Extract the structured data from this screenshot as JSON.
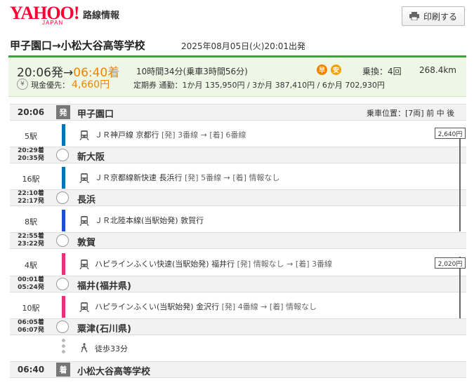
{
  "header": {
    "logo_text": "YAHOO!",
    "logo_sub": "JAPAN",
    "service_title": "路線情報",
    "print_label": "印刷する"
  },
  "route": {
    "title": "甲子園口→小松大谷高等学校",
    "date": "2025年08月05日(火)20:01出発"
  },
  "summary": {
    "dep_time": "20:06発",
    "arrow": "→",
    "arr_time": "06:40着",
    "duration": "10時間34分(乗車3時間56分)",
    "badge_fast": "早",
    "badge_cheap": "安",
    "transfers": "乗換：4回",
    "distance": "268.4km",
    "cash_label": "現金優先：",
    "fare": "4,660円",
    "teiki": "定期券 通勤：1か月 135,950円 / 3か月 387,410円 / 6か月 702,930円",
    "colors": {
      "accent": "#f08300",
      "green": "#3aa33a",
      "fast": "#f08300",
      "cheap": "#f5a200"
    }
  },
  "stations": [
    {
      "time": "20:06",
      "tag": "発",
      "name": "甲子園口",
      "seat": "乗車位置：[7両] 前 中 後"
    },
    {
      "arr": "20:29着",
      "dep": "20:35発",
      "name": "新大阪"
    },
    {
      "arr": "22:10着",
      "dep": "22:17発",
      "name": "長浜"
    },
    {
      "arr": "22:55着",
      "dep": "23:22発",
      "name": "敦賀"
    },
    {
      "arr": "00:01着",
      "dep": "05:24発",
      "name": "福井(福井県)"
    },
    {
      "arr": "06:05着",
      "dep": "06:07発",
      "name": "粟津(石川県)"
    },
    {
      "time": "06:40",
      "tag": "着",
      "name": "小松大谷高等学校"
    }
  ],
  "segments": [
    {
      "count": "5駅",
      "line": "ＪＲ神戸線 京都行",
      "dep_lbl": "[発]",
      "dep_track": "3番線",
      "arr_lbl": "[着]",
      "arr_track": "6番線",
      "color": "#0072bc"
    },
    {
      "count": "16駅",
      "line": "ＪＲ京都線新快速 長浜行",
      "dep_lbl": "[発]",
      "dep_track": "5番線",
      "arr_lbl": "[着]",
      "arr_track": "情報なし",
      "color": "#0072bc"
    },
    {
      "count": "8駅",
      "line": "ＪＲ北陸本線(当駅始発) 敦賀行",
      "color": "#1a4fd6"
    },
    {
      "count": "4駅",
      "line": "ハピラインふくい快速(当駅始発) 福井行",
      "dep_lbl": "[発]",
      "dep_track": "情報なし",
      "arr_lbl": "[着]",
      "arr_track": "3番線",
      "color": "#e8317a"
    },
    {
      "count": "10駅",
      "line": "ハピラインふくい(当駅始発) 金沢行",
      "dep_lbl": "[発]",
      "dep_track": "4番線",
      "arr_lbl": "[着]",
      "arr_track": "情報なし",
      "color": "#e8317a"
    }
  ],
  "walk": {
    "label": "徒歩33分"
  },
  "fares": [
    "2,640円",
    "2,020円"
  ],
  "arrow_char": "→"
}
